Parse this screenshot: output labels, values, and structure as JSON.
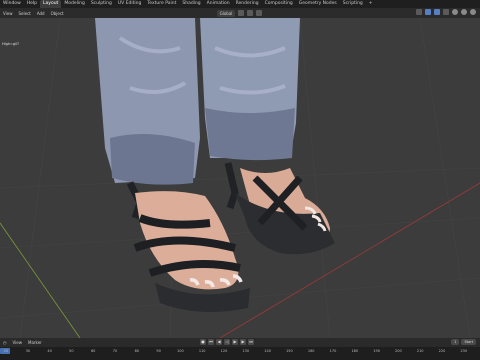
{
  "topbar": {
    "menus": [
      "Window",
      "Help"
    ],
    "tabs": [
      "Layout",
      "Modeling",
      "Sculpting",
      "UV Editing",
      "Texture Paint",
      "Shading",
      "Animation",
      "Rendering",
      "Compositing",
      "Geometry Nodes",
      "Scripting",
      "+"
    ]
  },
  "toolbar": {
    "items": [
      "View",
      "Select",
      "Add",
      "Object"
    ],
    "orientation": "Global"
  },
  "viewport": {
    "label": "High=gll?"
  },
  "timeline": {
    "items": [
      "View",
      "Marker"
    ],
    "start_label": "Start",
    "current_frame": "1",
    "ticks": [
      "20",
      "30",
      "40",
      "50",
      "60",
      "70",
      "80",
      "90",
      "100",
      "110",
      "120",
      "130",
      "140",
      "150",
      "160",
      "170",
      "180",
      "190",
      "200",
      "210",
      "220",
      "230"
    ]
  },
  "colors": {
    "accent": "#4772b3",
    "header": "#1f1f1f",
    "viewport": "#3c3c3c"
  }
}
